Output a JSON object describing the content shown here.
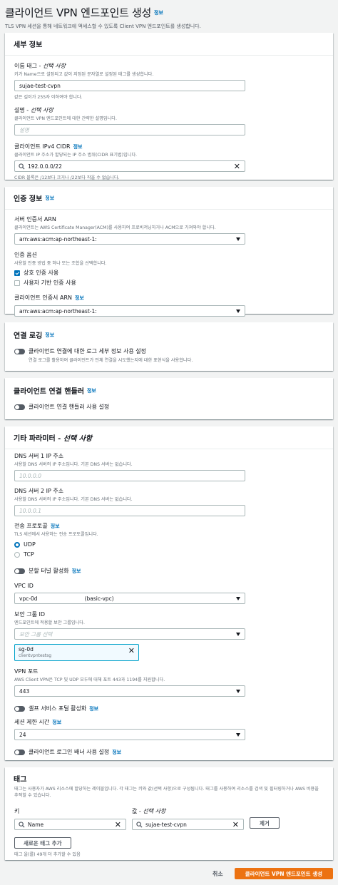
{
  "header": {
    "title": "클라이언트 VPN 엔드포인트 생성",
    "info": "정보",
    "description": "TLS VPN 세션을 통해 네트워크에 액세스할 수 있도록 Client VPN 엔드포인트를 생성합니다."
  },
  "details": {
    "title": "세부 정보",
    "name_tag_label": "이름 태그 - ",
    "name_tag_optional": "선택 사항",
    "name_tag_desc": "키가 Name으로 설정되고 값이 지정된 문자열로 설정된 태그를 생성합니다.",
    "name_tag_value": "sujae-test-cvpn",
    "name_tag_hint": "값은 길이가 255자 이하여야 합니다.",
    "desc_label": "설명 - ",
    "desc_optional": "선택 사항",
    "desc_desc": "클라이언트 VPN 엔드포인트에 대한 간략한 설명입니다.",
    "desc_placeholder": "설명",
    "cidr_label": "클라이언트 IPv4 CIDR",
    "cidr_info": "정보",
    "cidr_desc": "클라이언트 IP 주소가 할당되는 IP 주소 범위(CIDR 표기법)입니다.",
    "cidr_value": "192.0.0.0/22",
    "cidr_hint": "CIDR 블록은 /12보다 크거나 /22보다 작을 수 없습니다."
  },
  "auth": {
    "title": "인증 정보",
    "info": "정보",
    "server_cert_label": "서버 인증서 ARN",
    "server_cert_desc": "클라이언트는 AWS Certificate Manager(ACM)를 사용하여 프로비저닝하거나 ACM으로 가져와야 합니다.",
    "server_cert_value": "arn:aws:acm:ap-northeast-1:",
    "auth_options_label": "인증 옵션",
    "auth_options_desc": "사용할 인증 방법 중 하나 또는 조합을 선택합니다.",
    "option_mutual": "상호 인증 사용",
    "option_user": "사용자 기반 인증 사용",
    "client_cert_label": "클라이언트 인증서 ARN",
    "client_cert_info": "정보",
    "client_cert_value": "arn:aws:acm:ap-northeast-1:"
  },
  "logging": {
    "title": "연결 로깅",
    "info": "정보",
    "toggle_label": "클라이언트 연결에 대한 로그 세부 정보 사용 설정",
    "toggle_desc": "연결 로그를 활용하여 클라이언트가 인체 연결을 시도했는지에 대한 표현식을 사용합니다."
  },
  "handler": {
    "title": "클라이언트 연결 핸들러",
    "info": "정보",
    "toggle_label": "클라이언트 연결 핸들러 사용 설정"
  },
  "other": {
    "title": "기타 파라미터 - ",
    "title_optional": "선택 사항",
    "dns1_label": "DNS 서버 1 IP 주소",
    "dns1_desc": "사용할 DNS 서버의 IP 주소입니다. 기본 DNS 서버는 없습니다.",
    "dns1_placeholder": "10.0.0.0",
    "dns2_label": "DNS 서버 2 IP 주소",
    "dns2_desc": "사용할 DNS 서버의 IP 주소입니다. 기본 DNS 서버는 없습니다.",
    "dns2_placeholder": "10.0.0.1",
    "protocol_label": "전송 프로토콜",
    "protocol_info": "정보",
    "protocol_desc": "TLS 세션에서 사용하는 전송 프로토콜입니다.",
    "protocol_udp": "UDP",
    "protocol_tcp": "TCP",
    "split_label": "분할 터널 활성화",
    "split_info": "정보",
    "vpc_label": "VPC ID",
    "vpc_value_prefix": "vpc-0d",
    "vpc_value_suffix": "(basic-vpc)",
    "sg_label": "보안 그룹 ID",
    "sg_desc": "엔드포인트에 적용할 보안 그룹입니다.",
    "sg_placeholder": "보안 그룹 선택",
    "sg_token_id": "sg-0d",
    "sg_token_name": "clientvpntestsg",
    "port_label": "VPN 포트",
    "port_desc": "AWS Client VPN은 TCP 및 UDP 모두에 대해 포트 443과 1194를 지원합니다.",
    "port_value": "443",
    "portal_label": "셀프 서비스 포털 활성화",
    "portal_info": "정보",
    "timeout_label": "세션 제한 시간",
    "timeout_info": "정보",
    "timeout_value": "24",
    "banner_label": "클라이언트 로그인 배너 사용 설정",
    "banner_info": "정보"
  },
  "tags": {
    "title": "태그",
    "desc": "태그는 사용자가 AWS 리소스에 할당하는 레이블입니다. 각 태그는 키와 값(선택 사항)으로 구성됩니다. 태그를 사용하여 리소스를 검색 및 필터링하거나 AWS 비용을 추적할 수 있습니다.",
    "key_label": "키",
    "value_label": "값 - ",
    "value_optional": "선택 사항",
    "key_value": "Name",
    "value_value": "sujae-test-cvpn",
    "remove_label": "제거",
    "add_label": "새로운 태그 추가",
    "limit_hint": "태그 을(를) 49개 더 추가할 수 있음"
  },
  "footer": {
    "cancel_label": "취소",
    "submit_label": "클라이언트 VPN 엔드포인트 생성"
  },
  "colors": {
    "primary": "#ec7211",
    "link": "#0073bb",
    "token_border": "#00a1c9"
  }
}
